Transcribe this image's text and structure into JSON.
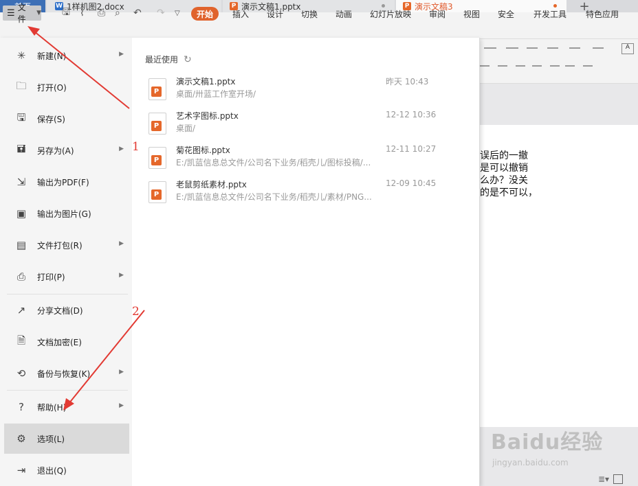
{
  "tabs": [
    {
      "label": "首页"
    },
    {
      "label": "1样机图2.docx"
    },
    {
      "label": "演示文稿1.pptx"
    },
    {
      "label": "演示文稿3"
    }
  ],
  "toolbar": {
    "file_label": "文件",
    "menu_tabs": [
      "开始",
      "插入",
      "设计",
      "切换",
      "动画",
      "幻灯片放映",
      "审阅",
      "视图",
      "安全",
      "开发工具",
      "特色应用"
    ]
  },
  "file_menu": {
    "items": [
      {
        "label": "新建(N)",
        "icon": "new-icon"
      },
      {
        "label": "打开(O)",
        "icon": "open-icon"
      },
      {
        "label": "保存(S)",
        "icon": "save-icon"
      },
      {
        "label": "另存为(A)",
        "icon": "save-as-icon"
      },
      {
        "label": "输出为PDF(F)",
        "icon": "pdf-icon"
      },
      {
        "label": "输出为图片(G)",
        "icon": "image-icon"
      },
      {
        "label": "文件打包(R)",
        "icon": "package-icon"
      },
      {
        "label": "打印(P)",
        "icon": "print-icon"
      },
      {
        "label": "分享文档(D)",
        "icon": "share-icon"
      },
      {
        "label": "文档加密(E)",
        "icon": "lock-icon"
      },
      {
        "label": "备份与恢复(K)",
        "icon": "backup-icon"
      },
      {
        "label": "帮助(H)",
        "icon": "help-icon"
      },
      {
        "label": "选项(L)",
        "icon": "gear-icon"
      },
      {
        "label": "退出(Q)",
        "icon": "exit-icon"
      }
    ]
  },
  "recent": {
    "title": "最近使用",
    "files": [
      {
        "name": "演示文稿1.pptx",
        "path": "桌面/卅蓝工作室开场/",
        "time": "昨天 10:43"
      },
      {
        "name": "艺术字图标.pptx",
        "path": "桌面/",
        "time": "12-12 10:36"
      },
      {
        "name": "菊花图标.pptx",
        "path": "E:/凯蓝信息总文件/公司名下业务/稻壳儿/图标投稿/...",
        "time": "12-11 10:27"
      },
      {
        "name": "老鼠剪纸素材.pptx",
        "path": "E:/凯蓝信息总文件/公司名下业务/稻壳儿/素材/PNG...",
        "time": "12-09 10:45"
      }
    ]
  },
  "slide_text": [
    "误后的一撤",
    "是可以撤销",
    "么办？没关",
    "的是不可以，"
  ],
  "annotations": [
    "1",
    "2"
  ],
  "watermark": {
    "main": "Baidu经验",
    "sub": "jingyan.baidu.com"
  },
  "colors": {
    "accent": "#e0632c",
    "home_tab": "#3c6fb6",
    "arrow": "#e23a33"
  }
}
